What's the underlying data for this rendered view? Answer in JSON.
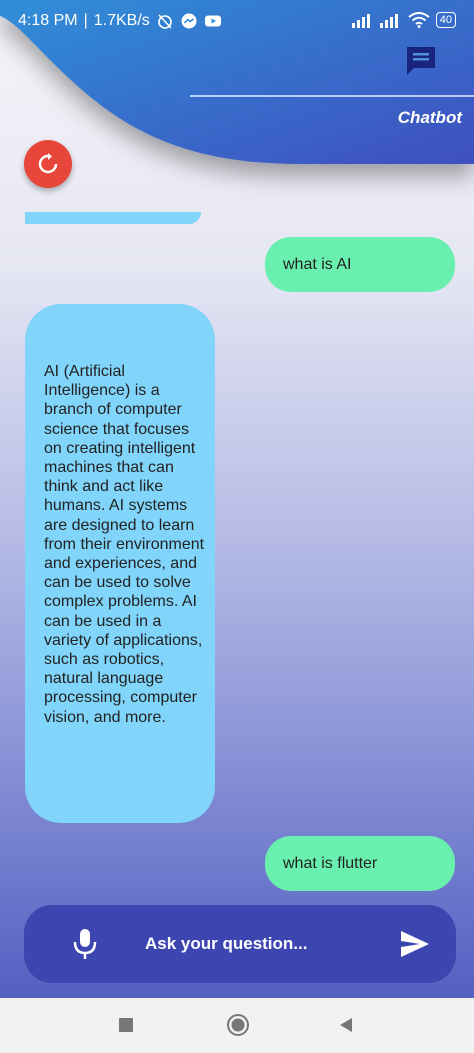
{
  "status_bar": {
    "time": "4:18 PM",
    "separator": "|",
    "speed": "1.7KB/s",
    "battery": "40"
  },
  "header": {
    "title": "Chatbot"
  },
  "messages": [
    {
      "role": "user",
      "text": "what is AI"
    },
    {
      "role": "bot",
      "text": "AI (Artificial Intelligence) is a branch of computer science that focuses on creating intelligent machines that can think and act like humans. AI systems are designed to learn from their environment and experiences, and can be used to solve complex problems. AI can be used in a variety of applications, such as robotics, natural language processing, computer vision, and more."
    },
    {
      "role": "user",
      "text": "what is flutter"
    }
  ],
  "input": {
    "placeholder": "Ask your question..."
  },
  "colors": {
    "user_bubble": "#69f0ae",
    "bot_bubble": "#81d4fa",
    "header": "#3f51b5",
    "refresh_button": "#e8463a",
    "input_bar": "#3d46b0"
  },
  "icons": [
    "chat-icon",
    "refresh-icon",
    "mic-icon",
    "send-icon",
    "nav-square-icon",
    "nav-circle-icon",
    "nav-back-icon"
  ]
}
